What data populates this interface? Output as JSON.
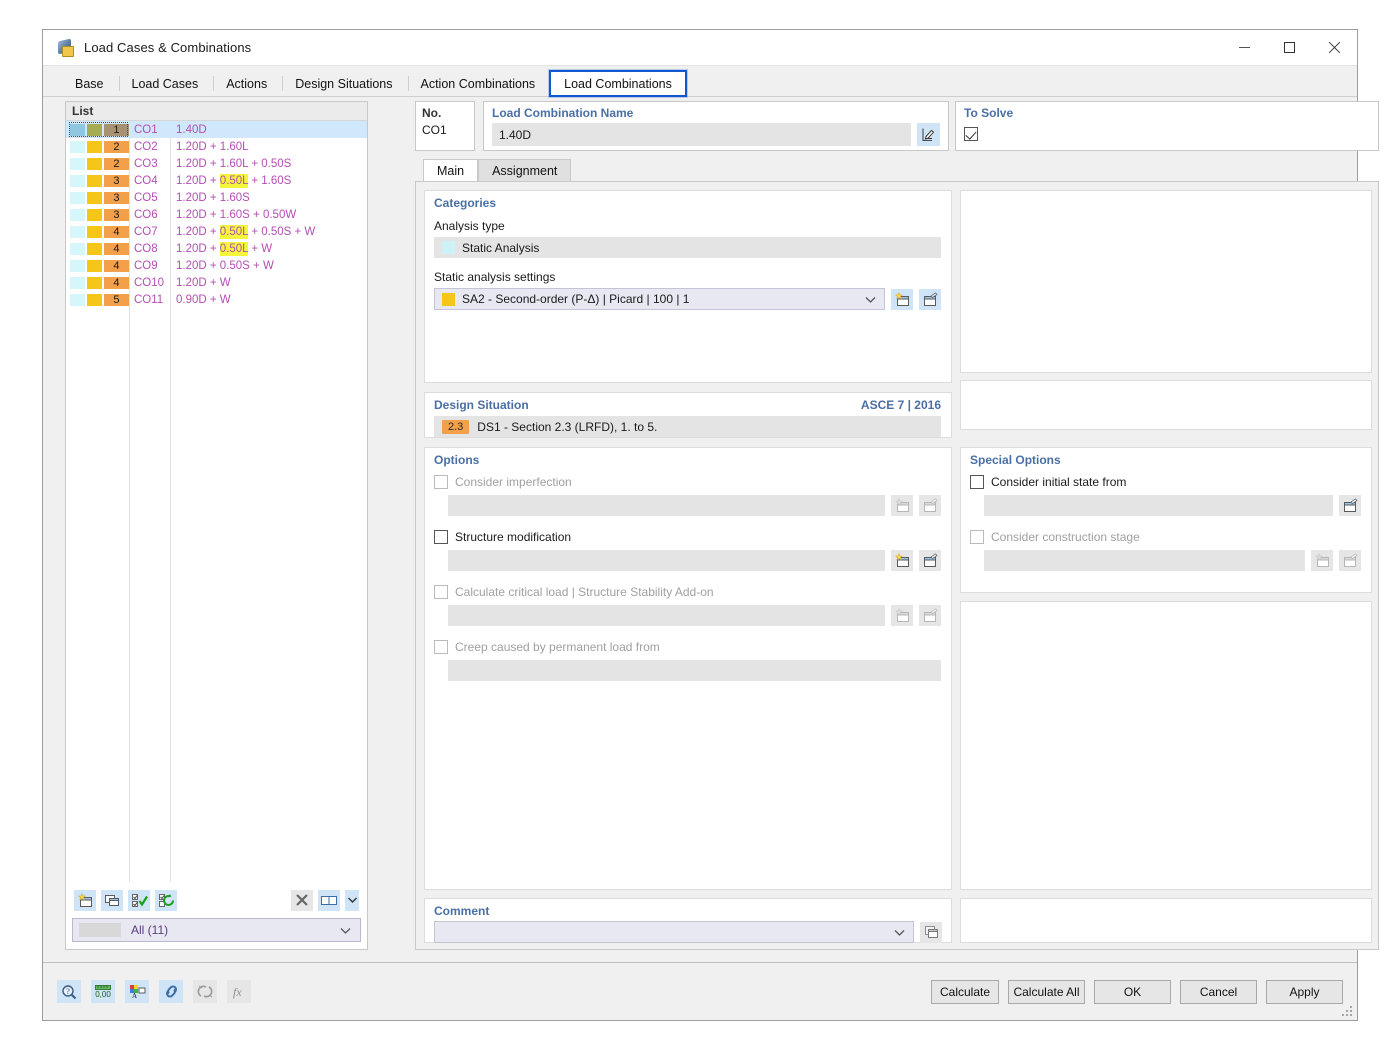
{
  "window": {
    "title": "Load Cases & Combinations",
    "icon": "app-icon",
    "controls": {
      "minimize": "minimize",
      "maximize": "maximize",
      "close": "close"
    }
  },
  "tabs": [
    {
      "label": "Base",
      "active": false
    },
    {
      "label": "Load Cases",
      "active": false
    },
    {
      "label": "Actions",
      "active": false
    },
    {
      "label": "Design Situations",
      "active": false
    },
    {
      "label": "Action Combinations",
      "active": false
    },
    {
      "label": "Load Combinations",
      "active": true
    }
  ],
  "list": {
    "header": "List",
    "rows": [
      {
        "num": "1",
        "no": "CO1",
        "formula_pre": "1.40D",
        "formula_hl": "",
        "formula_post": ""
      },
      {
        "num": "2",
        "no": "CO2",
        "formula_pre": "1.20D + 1.60L",
        "formula_hl": "",
        "formula_post": ""
      },
      {
        "num": "2",
        "no": "CO3",
        "formula_pre": "1.20D + 1.60L + 0.50S",
        "formula_hl": "",
        "formula_post": ""
      },
      {
        "num": "3",
        "no": "CO4",
        "formula_pre": "1.20D + ",
        "formula_hl": "0.50L",
        "formula_post": " + 1.60S"
      },
      {
        "num": "3",
        "no": "CO5",
        "formula_pre": "1.20D + 1.60S",
        "formula_hl": "",
        "formula_post": ""
      },
      {
        "num": "3",
        "no": "CO6",
        "formula_pre": "1.20D + 1.60S + 0.50W",
        "formula_hl": "",
        "formula_post": ""
      },
      {
        "num": "4",
        "no": "CO7",
        "formula_pre": "1.20D + ",
        "formula_hl": "0.50L",
        "formula_post": " + 0.50S + W"
      },
      {
        "num": "4",
        "no": "CO8",
        "formula_pre": "1.20D + ",
        "formula_hl": "0.50L",
        "formula_post": " + W"
      },
      {
        "num": "4",
        "no": "CO9",
        "formula_pre": "1.20D + 0.50S + W",
        "formula_hl": "",
        "formula_post": ""
      },
      {
        "num": "4",
        "no": "CO10",
        "formula_pre": "1.20D + W",
        "formula_hl": "",
        "formula_post": ""
      },
      {
        "num": "5",
        "no": "CO11",
        "formula_pre": "0.90D + W",
        "formula_hl": "",
        "formula_post": ""
      }
    ],
    "selected_index": 0,
    "filter": {
      "label": "All (11)"
    },
    "tools": [
      {
        "name": "new-combination-button",
        "icon": "new-window-icon"
      },
      {
        "name": "copy-combination-button",
        "icon": "copy-window-icon"
      },
      {
        "name": "select-all-button",
        "icon": "check-list-icon"
      },
      {
        "name": "refresh-selection-button",
        "icon": "refresh-list-icon"
      },
      {
        "name": "delete-combination-button",
        "icon": "close-x-icon"
      },
      {
        "name": "view-layout-button",
        "icon": "columns-icon"
      },
      {
        "name": "view-layout-dropdown",
        "icon": "chevron-down-icon"
      }
    ]
  },
  "detail": {
    "no": {
      "label": "No.",
      "value": "CO1"
    },
    "name": {
      "label": "Load Combination Name",
      "value": "1.40D",
      "edit_icon": "edit-pencil-icon"
    },
    "to_solve": {
      "label": "To Solve",
      "checked": true
    },
    "inner_tabs": [
      {
        "label": "Main",
        "active": true
      },
      {
        "label": "Assignment",
        "active": false
      }
    ],
    "categories": {
      "title": "Categories",
      "analysis_type_label": "Analysis type",
      "analysis_type_value": "Static Analysis",
      "analysis_type_color": "#ccf2f7",
      "settings_label": "Static analysis settings",
      "settings_value": "SA2 - Second-order (P-Δ) | Picard | 100 | 1",
      "settings_color": "#f5c518",
      "new_icon": "new-window-icon",
      "edit_icon": "edit-window-icon"
    },
    "design_situation": {
      "title": "Design Situation",
      "standard": "ASCE 7 | 2016",
      "badge": "2.3",
      "value": "DS1 - Section 2.3 (LRFD), 1. to 5."
    },
    "options": {
      "title": "Options",
      "items": [
        {
          "label": "Consider imperfection",
          "checked": false,
          "enabled": false,
          "has_field": true,
          "buttons": 2
        },
        {
          "label": "Structure modification",
          "checked": false,
          "enabled": true,
          "has_field": true,
          "buttons": 2
        },
        {
          "label": "Calculate critical load | Structure Stability Add-on",
          "checked": false,
          "enabled": false,
          "has_field": true,
          "buttons": 2
        },
        {
          "label": "Creep caused by permanent load from",
          "checked": false,
          "enabled": false,
          "has_field": true,
          "buttons": 0
        }
      ]
    },
    "special_options": {
      "title": "Special Options",
      "items": [
        {
          "label": "Consider initial state from",
          "checked": false,
          "enabled": true,
          "has_field": true,
          "buttons": 1
        },
        {
          "label": "Consider construction stage",
          "checked": false,
          "enabled": false,
          "has_field": true,
          "buttons": 2
        }
      ]
    },
    "comment": {
      "title": "Comment",
      "value": "",
      "icon": "copy-comment-icon"
    }
  },
  "footer": {
    "tools": [
      {
        "name": "info-button",
        "icon": "magnifier-question-icon",
        "enabled": true
      },
      {
        "name": "units-button",
        "icon": "units-000-icon",
        "enabled": true
      },
      {
        "name": "display-properties-button",
        "icon": "color-legend-icon",
        "enabled": true
      },
      {
        "name": "link-button",
        "icon": "chain-link-icon",
        "enabled": true
      },
      {
        "name": "relations-button",
        "icon": "relation-icon",
        "enabled": false
      },
      {
        "name": "formula-button",
        "icon": "function-fx-icon",
        "enabled": false
      }
    ],
    "buttons": [
      {
        "label": "Calculate"
      },
      {
        "label": "Calculate All"
      },
      {
        "label": "OK"
      },
      {
        "label": "Cancel"
      },
      {
        "label": "Apply"
      }
    ]
  }
}
